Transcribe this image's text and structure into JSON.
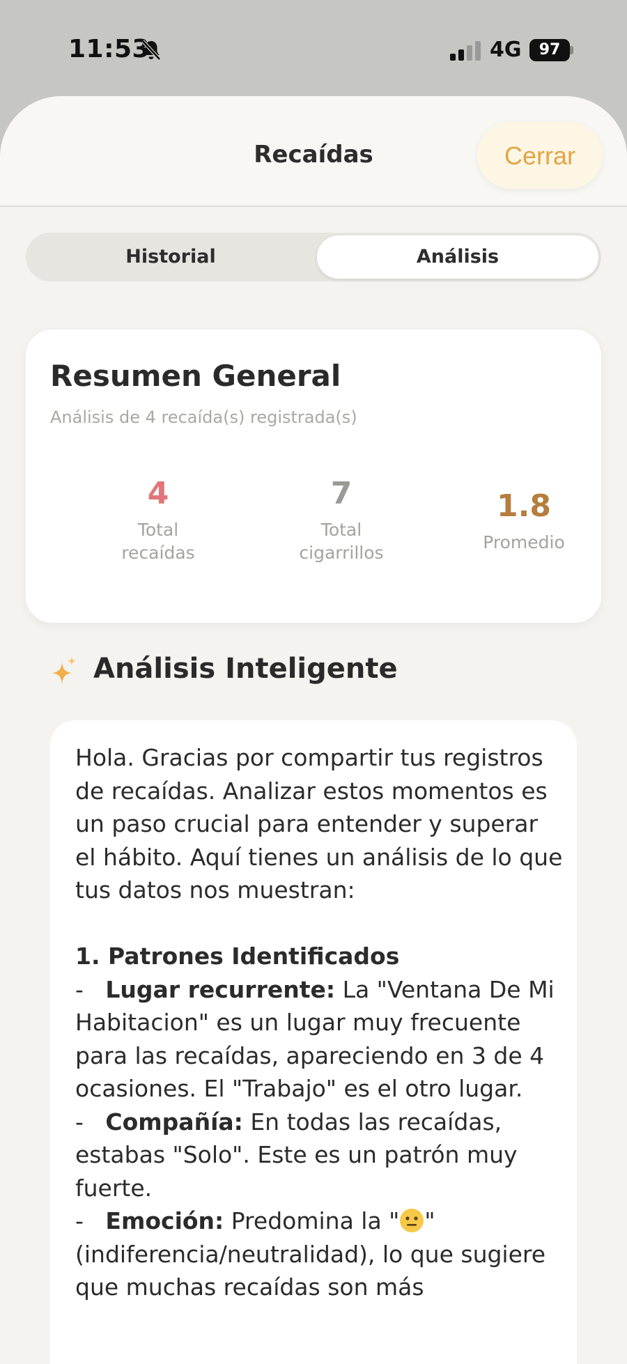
{
  "status_bar": {
    "time": "11:53",
    "network": "4G",
    "battery": "97"
  },
  "header": {
    "title": "Recaídas",
    "close_label": "Cerrar"
  },
  "tabs": [
    {
      "label": "Historial",
      "selected": false
    },
    {
      "label": "Análisis",
      "selected": true
    }
  ],
  "summary": {
    "title": "Resumen General",
    "subtitle": "Análisis de 4 recaída(s) registrada(s)",
    "stats": [
      {
        "value": "4",
        "label": "Total recaídas",
        "color": "#e0767a"
      },
      {
        "value": "7",
        "label": "Total cigarrillos",
        "color": "#9a9a97"
      },
      {
        "value": "1.8",
        "label": "Promedio",
        "color": "#b57d3e"
      }
    ]
  },
  "ai_analysis": {
    "title": "Análisis Inteligente",
    "intro": "Hola. Gracias por compartir tus registros de recaídas. Analizar estos momentos es un paso crucial para entender y superar el hábito. Aquí tienes un análisis de lo que tus datos nos muestran:",
    "section_heading": "1. Patrones Identificados",
    "bullets": [
      {
        "prefix": "-",
        "label": "Lugar recurrente:",
        "text": " La \"Ventana De Mi Habitacion\" es un lugar muy frecuente para las recaídas, apareciendo en 3 de 4 ocasiones. El \"Trabajo\" es el otro lugar."
      },
      {
        "prefix": "-",
        "label": "Compañía:",
        "text": " En todas las recaídas, estabas \"Solo\". Este es un patrón muy fuerte."
      },
      {
        "prefix": "-",
        "label": "Emoción:",
        "text_before": " Predomina la \"",
        "text_after": "\" (indiferencia/neutralidad), lo que sugiere que muchas recaídas son más"
      }
    ]
  },
  "colors": {
    "accent": "#e1a544",
    "sheet_bg": "#f4f3ef",
    "card_bg": "#ffffff"
  },
  "icons": [
    "bell-slash-icon",
    "signal-icon",
    "sparkles-icon",
    "neutral-face-emoji-icon"
  ]
}
